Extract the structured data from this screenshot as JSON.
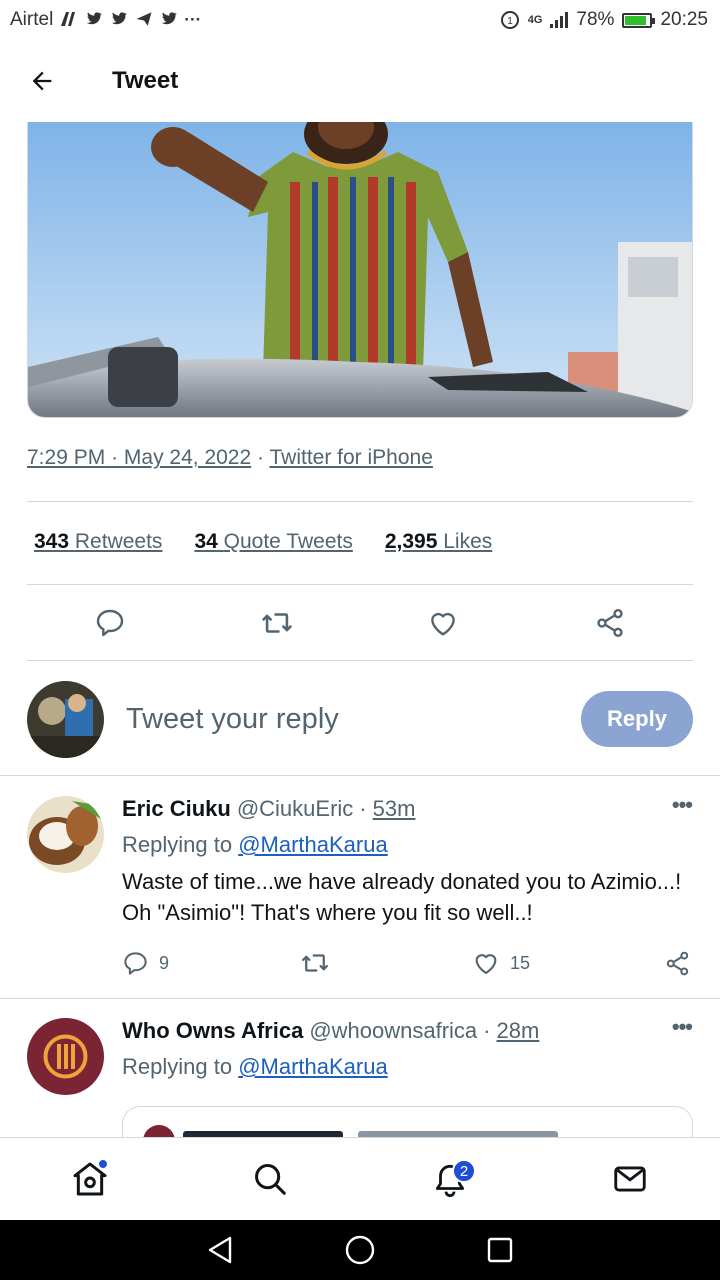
{
  "status_bar": {
    "carrier": "Airtel",
    "notification_icons": [
      "N",
      "🐦",
      "🐦",
      "➤",
      "🐦",
      "···"
    ],
    "network": "4G",
    "battery": "78%",
    "battery_level": 0.78,
    "time": "20:25"
  },
  "header": {
    "title": "Tweet",
    "back_icon": "arrow-left-icon"
  },
  "tweet": {
    "time": "7:29 PM",
    "date": "May 24, 2022",
    "source": "Twitter for iPhone",
    "separator": "·",
    "stats": {
      "retweets_count": "343",
      "retweets_label": "Retweets",
      "quotes_count": "34",
      "quotes_label": "Quote Tweets",
      "likes_count": "2,395",
      "likes_label": "Likes"
    },
    "actions": [
      "reply-icon",
      "retweet-icon",
      "like-icon",
      "share-icon"
    ]
  },
  "composer": {
    "placeholder": "Tweet your reply",
    "button_label": "Reply"
  },
  "replies": [
    {
      "name": "Eric Ciuku",
      "handle": "@CiukuEric",
      "time": "53m",
      "replying_prefix": "Replying to",
      "replying_to": "@MarthaKarua",
      "text": "Waste of time...we have already donated you to Azimio...! Oh \"Asimio\"! That's where you fit so well..!",
      "reply_count": "9",
      "retweet_count": "",
      "like_count": "15"
    },
    {
      "name": "Who Owns Africa",
      "handle": "@whoownsafrica",
      "time": "28m",
      "replying_prefix": "Replying to",
      "replying_to": "@MarthaKarua"
    }
  ],
  "more_label": "•••",
  "bottom_nav": {
    "items": [
      "home-icon",
      "search-icon",
      "notifications-icon",
      "messages-icon"
    ],
    "notification_badge": "2"
  },
  "colors": {
    "accent": "#1d4ed8",
    "reply_button": "#8ba4d1",
    "muted_text": "#536471",
    "divider": "#cfd9de"
  }
}
